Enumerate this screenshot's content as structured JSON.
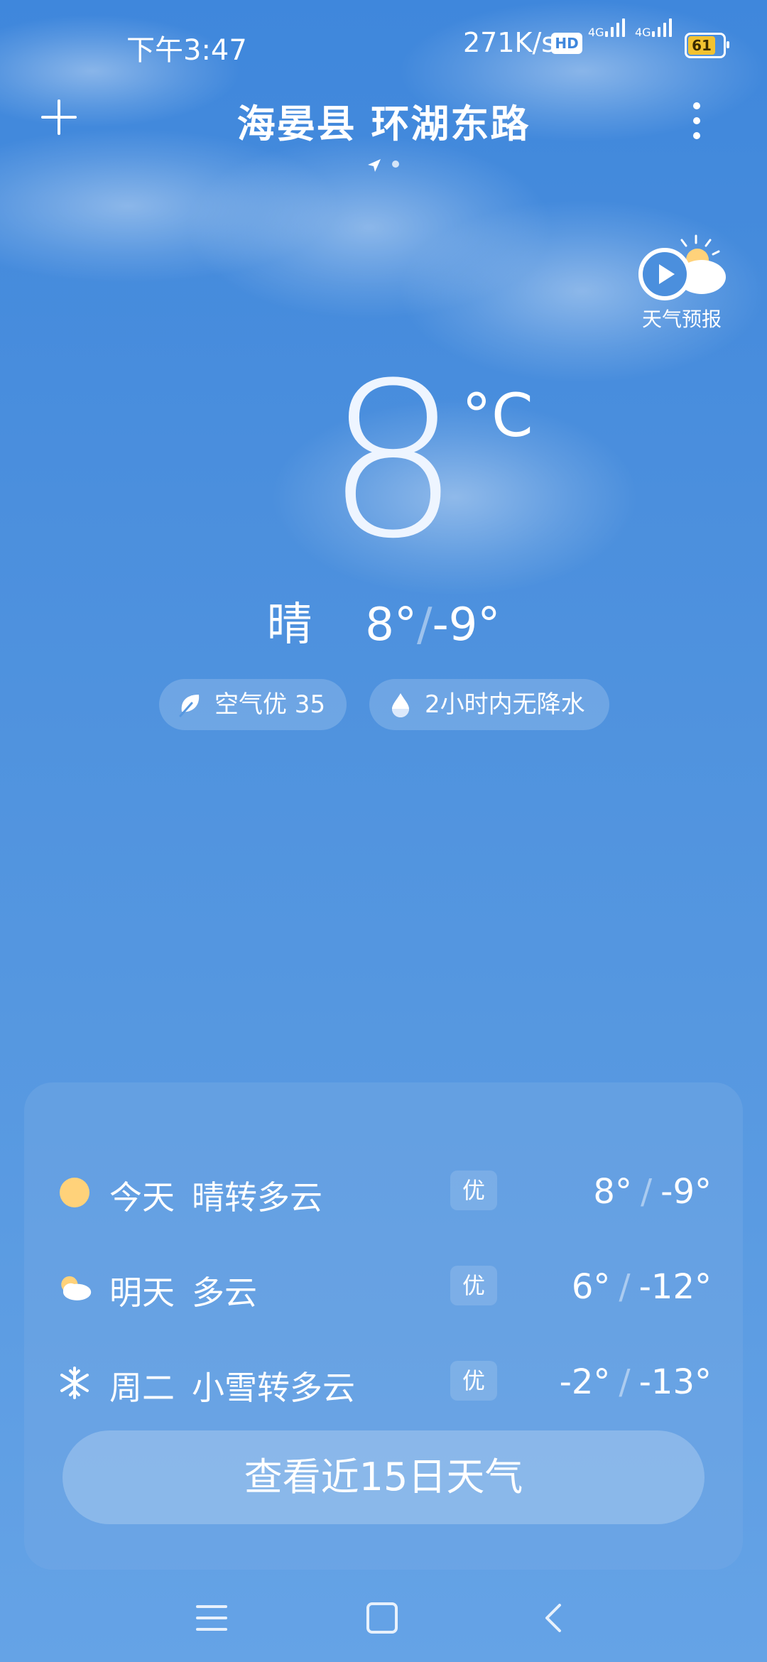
{
  "status_bar": {
    "time": "下午3:47",
    "net_speed": "271K/s",
    "hd_label": "HD",
    "signal1_label": "4G",
    "signal2_label": "4G",
    "battery": "61"
  },
  "header": {
    "location": "海晏县 环湖东路"
  },
  "forecast_button": {
    "label": "天气预报"
  },
  "current": {
    "temperature": "8",
    "unit": "°C",
    "condition": "晴",
    "high": "8°",
    "low": "-9°"
  },
  "chips": {
    "air": "空气优 35",
    "rain": "2小时内无降水"
  },
  "daily": [
    {
      "day": "今天",
      "condition": "晴转多云",
      "aqi": "优",
      "high": "8°",
      "low": "-9°",
      "icon": "sun-icon"
    },
    {
      "day": "明天",
      "condition": "多云",
      "aqi": "优",
      "high": "6°",
      "low": "-12°",
      "icon": "cloudy-icon"
    },
    {
      "day": "周二",
      "condition": "小雪转多云",
      "aqi": "优",
      "high": "-2°",
      "low": "-13°",
      "icon": "snow-icon"
    }
  ],
  "more_button": "查看近15日天气",
  "colors": {
    "sky_top": "#3f87dc",
    "sky_bottom": "#65a3e6",
    "sun": "#ffd27a",
    "battery": "#f2c230"
  }
}
